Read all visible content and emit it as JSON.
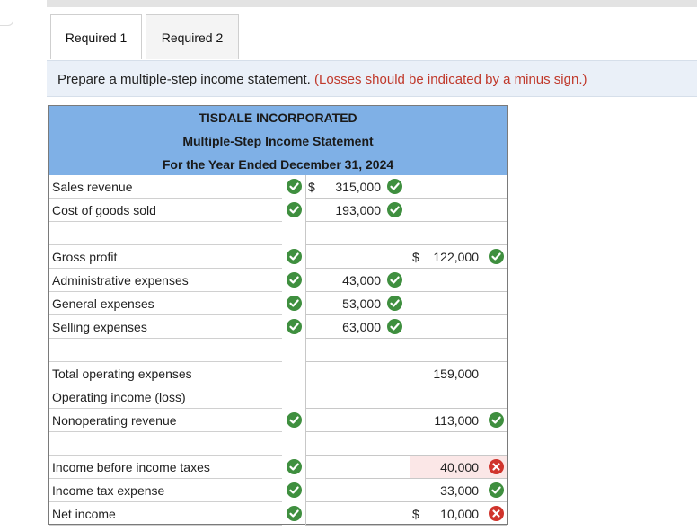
{
  "tabs": [
    {
      "label": "Required 1"
    },
    {
      "label": "Required 2"
    }
  ],
  "instruction": {
    "text": "Prepare a multiple-step income statement.",
    "note": "(Losses should be indicated by a minus sign.)"
  },
  "statement": {
    "company": "TISDALE INCORPORATED",
    "title": "Multiple-Step Income Statement",
    "period": "For the Year Ended December 31, 2024",
    "rows": [
      {
        "label": "Sales revenue",
        "c1_currency": "$",
        "c1": "315,000",
        "c2_currency": "",
        "c2": ""
      },
      {
        "label": "Cost of goods sold",
        "c1": "193,000",
        "c2": ""
      },
      {
        "label": "",
        "c1": "",
        "c2": ""
      },
      {
        "label": "Gross profit",
        "c1": "",
        "c2_currency": "$",
        "c2": "122,000"
      },
      {
        "label": "Administrative expenses",
        "c1": "43,000",
        "c2": ""
      },
      {
        "label": "General expenses",
        "c1": "53,000",
        "c2": ""
      },
      {
        "label": "Selling expenses",
        "c1": "63,000",
        "c2": ""
      },
      {
        "label": "",
        "c1": "",
        "c2": ""
      },
      {
        "label": "Total operating expenses",
        "c1": "",
        "c2": "159,000"
      },
      {
        "label": "Operating income (loss)",
        "c1": "",
        "c2": ""
      },
      {
        "label": "Nonoperating revenue",
        "c1": "",
        "c2": "113,000"
      },
      {
        "label": "",
        "c1": "",
        "c2": ""
      },
      {
        "label": "Income before income taxes",
        "c1": "",
        "c2": "40,000"
      },
      {
        "label": "Income tax expense",
        "c1": "",
        "c2": "33,000"
      },
      {
        "label": "Net income",
        "c1": "",
        "c2_currency": "$",
        "c2": "10,000"
      }
    ]
  },
  "colors": {
    "header_bg": "#7fb0e6",
    "correct": "#3f8f3f",
    "incorrect": "#d0342c",
    "note_red": "#c0392b"
  },
  "icons": {
    "correct": "check-circle-icon",
    "incorrect": "x-circle-icon"
  }
}
